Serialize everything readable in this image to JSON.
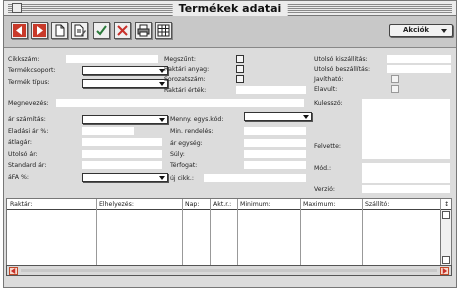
{
  "window": {
    "title": "Termékek adatai"
  },
  "toolbar": {
    "buttons": [
      "prev-arrow-icon",
      "next-arrow-icon",
      "new-doc-icon",
      "edit-icon",
      "check-icon",
      "delete-icon",
      "print-icon",
      "grid-icon"
    ],
    "actions_label": "Akciók"
  },
  "form": {
    "cikkszam": "Cikkszám:",
    "termekcsoport": "Termékcsoport:",
    "termek_tipus": "Termék típus:",
    "megnevezes": "Megnevezés:",
    "ar_szamitas": "ár számítás:",
    "eladasi_ar": "Eladási ár %:",
    "atlagar": "átlagár:",
    "utolso_ar": "Utolsó ár:",
    "standard_ar": "Standard ár:",
    "afa": "áFA %:",
    "megszunt": "Megszűnt:",
    "raktari_anyag": "Raktári anyag:",
    "sorozatszam": "Sorozatszám:",
    "raktari_ertek": "Raktári érték:",
    "menny_egys_kod": "Menny. egys.kód:",
    "min_rendeles": "Min. rendelés:",
    "ar_egyseg": "ár egység:",
    "suly": "Súly:",
    "terfogat": "Térfogat:",
    "uj_cikk": "új cikk.:",
    "utolso_kiszallitas": "Utolsó kiszállítás:",
    "utolso_beszallitas": "Utolsó beszállítás:",
    "javithato": "Javítható:",
    "elavult": "Elavult:",
    "kulesszo": "Kulesszó:",
    "felvette": "Felvette:",
    "mod": "Mód.:",
    "verzio": "Verzió:"
  },
  "table": {
    "columns": [
      "Raktár:",
      "Elhelyezés:",
      "Nap:",
      "Akt.r.:",
      "Minimum:",
      "Maximum:",
      "Szállító:",
      "↕"
    ]
  }
}
